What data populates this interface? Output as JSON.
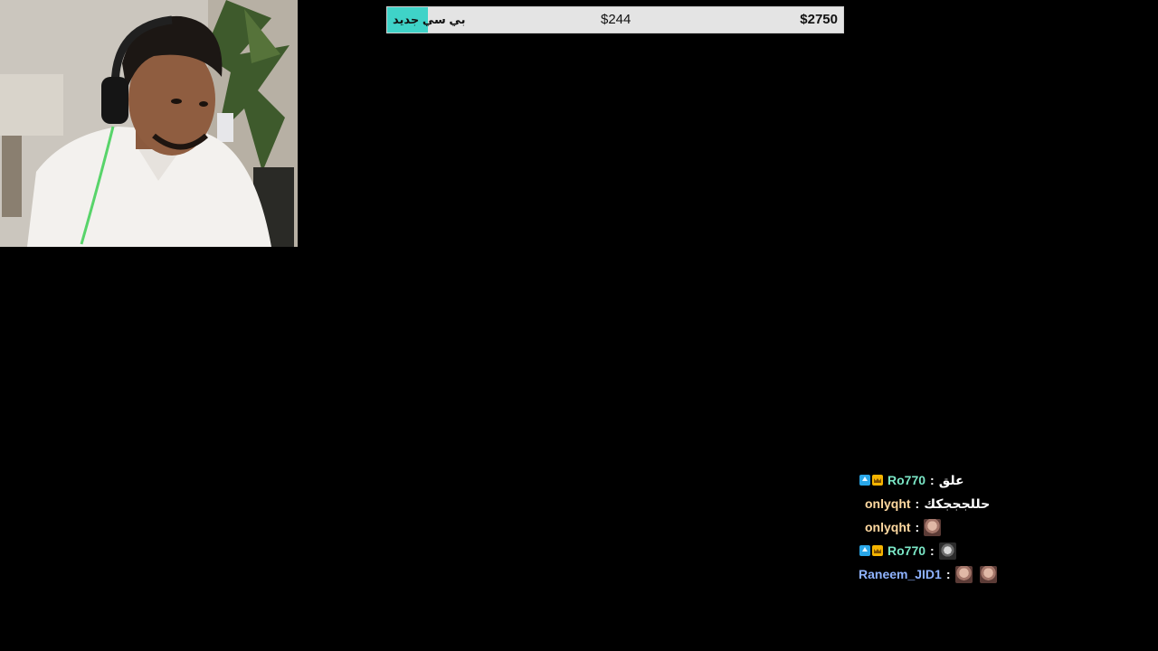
{
  "goal": {
    "title": "بي سي جديد",
    "current": "$244",
    "target": "$2750",
    "progress": 0.089,
    "fill_color": "#3fd3c8"
  },
  "chat": {
    "messages": [
      {
        "badges": [
          "arrow-badge-icon",
          "crown-badge-icon"
        ],
        "user": "Ro770",
        "user_color": "#7be7c7",
        "sep": ":",
        "text": "علق",
        "emotes": []
      },
      {
        "badges": [],
        "user": "onlyqht",
        "user_color": "#ffd9a0",
        "sep": ":",
        "text": "حللجججكك",
        "emotes": []
      },
      {
        "badges": [],
        "user": "onlyqht",
        "user_color": "#ffd9a0",
        "sep": ":",
        "text": "",
        "emotes": [
          "face-emote-icon"
        ]
      },
      {
        "badges": [
          "arrow-badge-icon",
          "crown-badge-icon"
        ],
        "user": "Ro770",
        "user_color": "#7be7c7",
        "sep": ":",
        "text": "",
        "emotes": [
          "mono-face-emote-icon"
        ]
      },
      {
        "badges": [],
        "user": "Raneem_JID1",
        "user_color": "#8fb3ff",
        "sep": ":",
        "text": "",
        "emotes": [
          "face-emote-icon",
          "face-emote-icon"
        ]
      }
    ]
  }
}
